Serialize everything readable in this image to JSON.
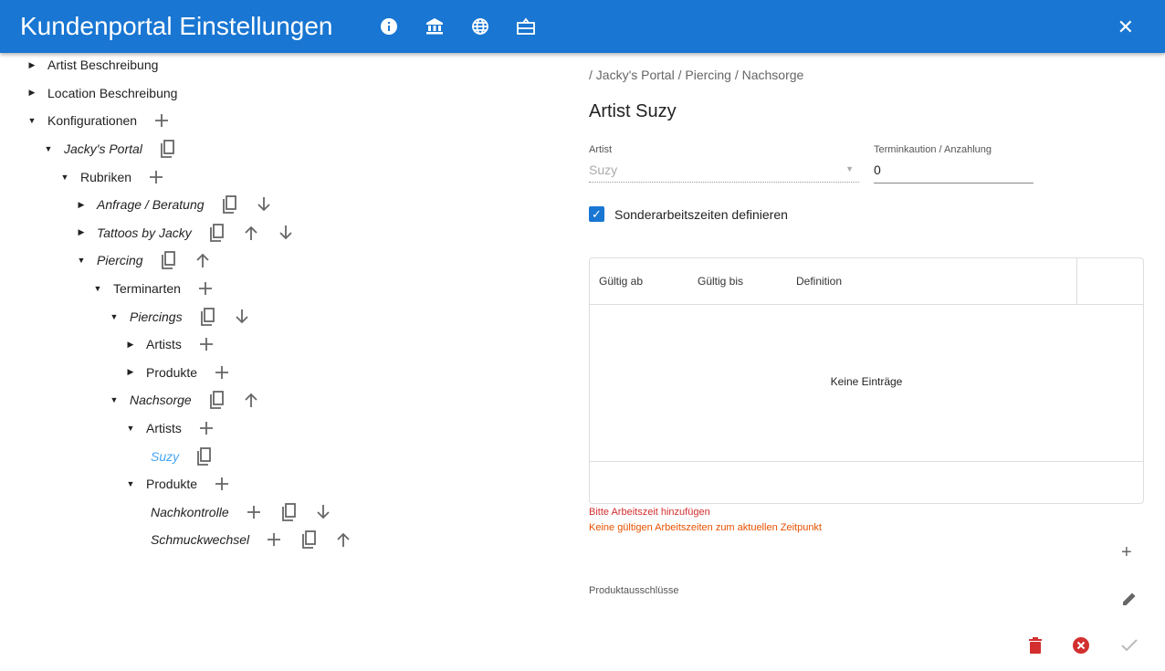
{
  "header": {
    "title": "Kundenportal Einstellungen",
    "icons": [
      "info-icon",
      "bank-icon",
      "globe-icon",
      "gift-card-icon",
      "close-icon"
    ]
  },
  "tree": [
    {
      "label": "Artist Beschreibung",
      "level": 0,
      "arrow": "right",
      "italic": false,
      "icons": []
    },
    {
      "label": "Location Beschreibung",
      "level": 0,
      "arrow": "right",
      "italic": false,
      "icons": []
    },
    {
      "label": "Konfigurationen",
      "level": 0,
      "arrow": "down",
      "italic": false,
      "icons": [
        "add"
      ]
    },
    {
      "label": "Jacky's Portal",
      "level": 1,
      "arrow": "down",
      "italic": true,
      "icons": [
        "copy"
      ]
    },
    {
      "label": "Rubriken",
      "level": 2,
      "arrow": "down",
      "italic": false,
      "icons": [
        "add"
      ]
    },
    {
      "label": "Anfrage / Beratung",
      "level": 3,
      "arrow": "right",
      "italic": true,
      "icons": [
        "copy",
        "down"
      ]
    },
    {
      "label": "Tattoos by Jacky",
      "level": 3,
      "arrow": "right",
      "italic": true,
      "icons": [
        "copy",
        "up",
        "down"
      ]
    },
    {
      "label": "Piercing",
      "level": 3,
      "arrow": "down",
      "italic": true,
      "icons": [
        "copy",
        "up"
      ]
    },
    {
      "label": "Terminarten",
      "level": 4,
      "arrow": "down",
      "italic": false,
      "icons": [
        "add"
      ]
    },
    {
      "label": "Piercings",
      "level": 5,
      "arrow": "down",
      "italic": true,
      "icons": [
        "copy",
        "down"
      ]
    },
    {
      "label": "Artists",
      "level": 6,
      "arrow": "right",
      "italic": false,
      "icons": [
        "add"
      ]
    },
    {
      "label": "Produkte",
      "level": 6,
      "arrow": "right",
      "italic": false,
      "icons": [
        "add"
      ]
    },
    {
      "label": "Nachsorge",
      "level": 5,
      "arrow": "down",
      "italic": true,
      "icons": [
        "copy",
        "up"
      ]
    },
    {
      "label": "Artists",
      "level": 6,
      "arrow": "down",
      "italic": false,
      "icons": [
        "add"
      ]
    },
    {
      "label": "Suzy",
      "level": 7,
      "arrow": "",
      "italic": true,
      "selected": true,
      "icons": [
        "copy"
      ]
    },
    {
      "label": "Produkte",
      "level": 6,
      "arrow": "down",
      "italic": false,
      "icons": [
        "add"
      ]
    },
    {
      "label": "Nachkontrolle",
      "level": 7,
      "arrow": "",
      "italic": true,
      "icons": [
        "add",
        "copy",
        "down"
      ]
    },
    {
      "label": "Schmuckwechsel",
      "level": 7,
      "arrow": "",
      "italic": true,
      "icons": [
        "add",
        "copy",
        "up"
      ]
    }
  ],
  "detail": {
    "breadcrumb": "/ Jacky's Portal / Piercing / Nachsorge",
    "title": "Artist Suzy",
    "artist_label": "Artist",
    "artist_value": "Suzy",
    "deposit_label": "Terminkaution / Anzahlung",
    "deposit_value": "0",
    "checkbox_label": "Sonderarbeitszeiten definieren",
    "checkbox_checked": true,
    "table_headers": [
      "Gültig ab",
      "Gültig bis",
      "Definition"
    ],
    "table_empty": "Keine Einträge",
    "error1": "Bitte Arbeitszeit hinzufügen",
    "error2": "Keine gültigen Arbeitszeiten zum aktuellen Zeitpunkt",
    "exclusions_label": "Produktausschlüsse"
  },
  "colors": {
    "primary": "#1976d2",
    "error": "#d32f2f",
    "warning": "#e65100",
    "selected": "#42a5f5"
  }
}
